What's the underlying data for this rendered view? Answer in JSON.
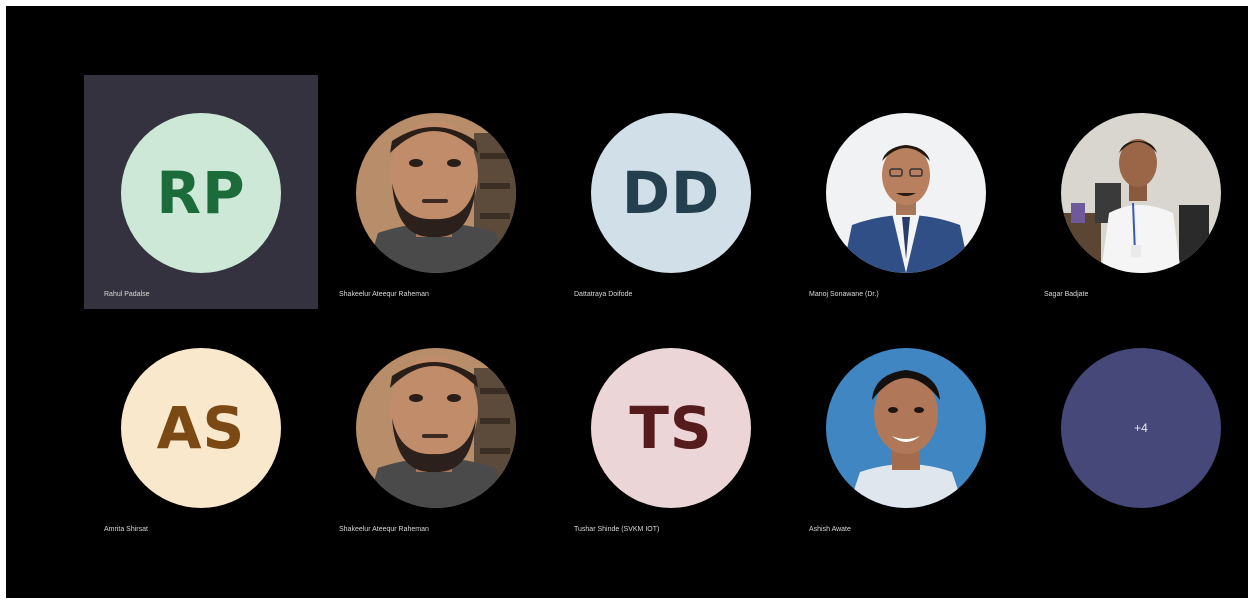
{
  "participants": [
    {
      "name": "Rahul Padalse",
      "initials": "RP",
      "avatar_bg": "#cde8d6",
      "initials_color": "#1c6b3b",
      "active": true
    },
    {
      "name": "Shakeelur Ateequr Raheman",
      "photo": "man-beard-photo"
    },
    {
      "name": "Dattatraya Doifode",
      "initials": "DD",
      "avatar_bg": "#d1dfe8",
      "initials_color": "#24404f"
    },
    {
      "name": "Manoj Sonawane (Dr.)",
      "photo": "man-suit-photo"
    },
    {
      "name": "Sagar Badjate",
      "photo": "man-office-photo"
    },
    {
      "name": "Amrita Shirsat",
      "initials": "AS",
      "avatar_bg": "#fae8cc",
      "initials_color": "#7b4a14"
    },
    {
      "name": "Shakeelur Ateequr Raheman",
      "photo": "man-beard-photo"
    },
    {
      "name": "Tushar Shinde (SVKM IOT)",
      "initials": "TS",
      "avatar_bg": "#ecd5d7",
      "initials_color": "#561b1c"
    },
    {
      "name": "Ashish Awate",
      "photo": "man-smiling-photo"
    }
  ],
  "overflow": {
    "label": "+4",
    "avatar_bg": "#454879"
  }
}
